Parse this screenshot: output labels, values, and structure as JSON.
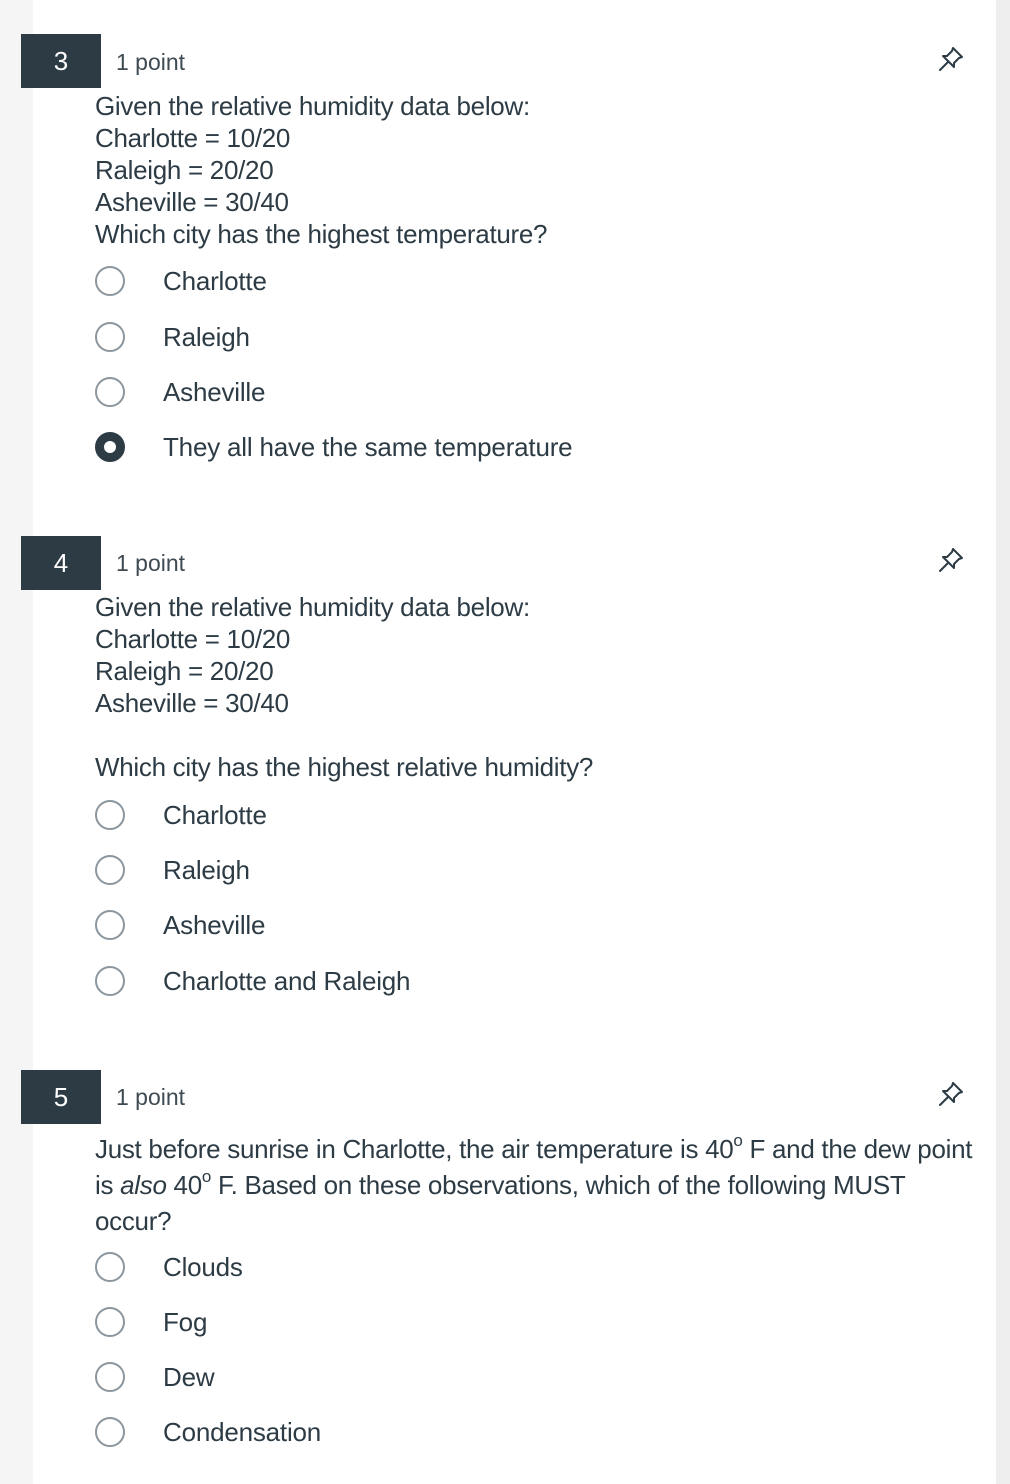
{
  "questions": [
    {
      "number": "3",
      "points": "1 point",
      "text_lines": [
        "Given the relative humidity data below:",
        "Charlotte = 10/20",
        "Raleigh = 20/20",
        "Asheville = 30/40",
        "Which city has the highest temperature?"
      ],
      "options": [
        {
          "label": "Charlotte",
          "selected": false
        },
        {
          "label": "Raleigh",
          "selected": false
        },
        {
          "label": "Asheville",
          "selected": false
        },
        {
          "label": "They all have the same temperature",
          "selected": true
        }
      ]
    },
    {
      "number": "4",
      "points": "1 point",
      "text_lines": [
        "Given the relative humidity data below:",
        "Charlotte = 10/20",
        "Raleigh = 20/20",
        "Asheville = 30/40",
        "",
        "Which city has the highest relative humidity?"
      ],
      "options": [
        {
          "label": "Charlotte",
          "selected": false
        },
        {
          "label": "Raleigh",
          "selected": false
        },
        {
          "label": "Asheville",
          "selected": false
        },
        {
          "label": "Charlotte and Raleigh",
          "selected": false
        }
      ]
    },
    {
      "number": "5",
      "points": "1 point",
      "text_parts": {
        "p1": "Just before sunrise in Charlotte,  the air temperature is 40",
        "deg1": "o",
        "p2": " F and the dew point is ",
        "em": "also",
        "p3": " 40",
        "deg2": "o",
        "p4": " F.  Based on these observations, which of the following MUST occur?"
      },
      "options": [
        {
          "label": "Clouds",
          "selected": false
        },
        {
          "label": "Fog",
          "selected": false
        },
        {
          "label": "Dew",
          "selected": false
        },
        {
          "label": "Condensation",
          "selected": false
        }
      ]
    }
  ],
  "icons": {
    "pin": "pin-icon"
  },
  "colors": {
    "number_badge_bg": "#2d3b45",
    "text": "#2d3b45",
    "radio_border": "#8b969e"
  }
}
